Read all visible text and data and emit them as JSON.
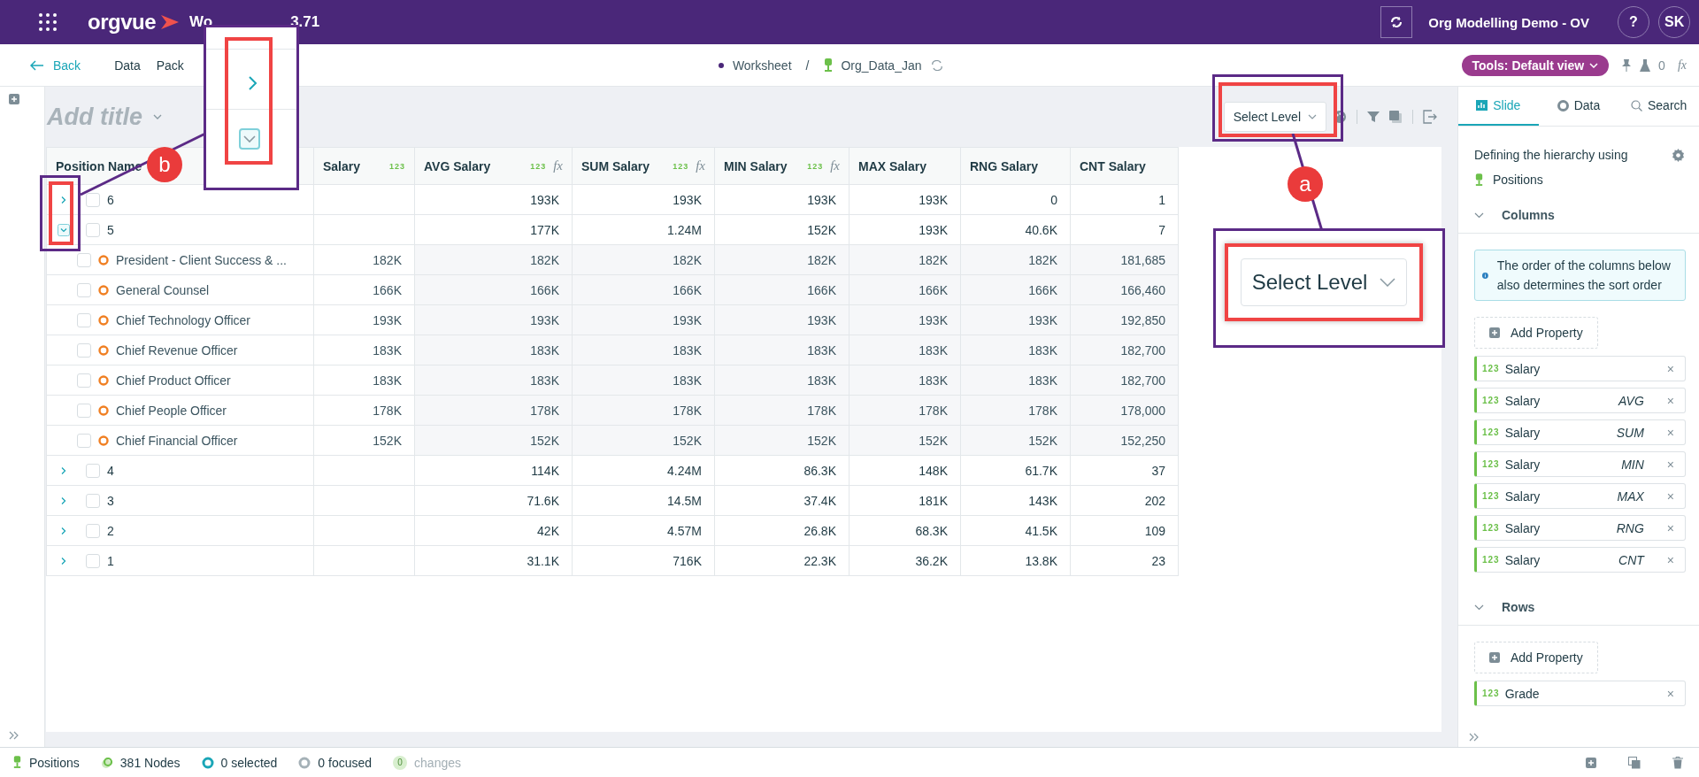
{
  "top_bar": {
    "app_name": "orgvue",
    "title_start": "Wo",
    "title_end": "3.71",
    "project": "Org Modelling Demo - OV",
    "help": "?",
    "avatar": "SK"
  },
  "nav": {
    "back": "Back",
    "items": [
      "Data",
      "Pack"
    ],
    "breadcrumb": [
      "Worksheet",
      "/",
      "Org_Data_Jan"
    ],
    "tools": "Tools: Default view",
    "count": "0",
    "fx": "fx"
  },
  "toolbar": {
    "title_placeholder": "Add title",
    "select_level": "Select Level"
  },
  "table": {
    "columns": [
      {
        "label": "Position Name"
      },
      {
        "label": "Salary",
        "tag": "123"
      },
      {
        "label": "AVG Salary",
        "tag": "123",
        "fx": "fx"
      },
      {
        "label": "SUM Salary",
        "tag": "123",
        "fx": "fx"
      },
      {
        "label": "MIN Salary",
        "tag": "123",
        "fx": "fx"
      },
      {
        "label": "MAX Salary"
      },
      {
        "label": "RNG Salary"
      },
      {
        "label": "CNT Salary"
      }
    ],
    "rows": [
      {
        "kind": "group",
        "expanded": false,
        "checked": false,
        "cells": [
          "6",
          "",
          "193K",
          "193K",
          "193K",
          "193K",
          "0",
          "1"
        ]
      },
      {
        "kind": "group",
        "expanded": true,
        "checked": false,
        "cells": [
          "5",
          "",
          "177K",
          "1.24M",
          "152K",
          "193K",
          "40.6K",
          "7"
        ]
      },
      {
        "kind": "position",
        "checked": false,
        "cells": [
          "President -  Client Success & ...",
          "182K",
          "182K",
          "182K",
          "182K",
          "182K",
          "182K",
          "181,685"
        ]
      },
      {
        "kind": "position",
        "checked": false,
        "cells": [
          "General Counsel",
          "166K",
          "166K",
          "166K",
          "166K",
          "166K",
          "166K",
          "166,460"
        ]
      },
      {
        "kind": "position",
        "checked": false,
        "cells": [
          "Chief Technology Officer",
          "193K",
          "193K",
          "193K",
          "193K",
          "193K",
          "193K",
          "192,850"
        ]
      },
      {
        "kind": "position",
        "checked": false,
        "cells": [
          "Chief Revenue Officer",
          "183K",
          "183K",
          "183K",
          "183K",
          "183K",
          "183K",
          "182,700"
        ]
      },
      {
        "kind": "position",
        "checked": false,
        "cells": [
          "Chief Product Officer",
          "183K",
          "183K",
          "183K",
          "183K",
          "183K",
          "183K",
          "182,700"
        ]
      },
      {
        "kind": "position",
        "checked": false,
        "cells": [
          "Chief People Officer",
          "178K",
          "178K",
          "178K",
          "178K",
          "178K",
          "178K",
          "178,000"
        ]
      },
      {
        "kind": "position",
        "checked": false,
        "cells": [
          "Chief Financial Officer",
          "152K",
          "152K",
          "152K",
          "152K",
          "152K",
          "152K",
          "152,250"
        ]
      },
      {
        "kind": "group",
        "expanded": false,
        "checked": false,
        "cells": [
          "4",
          "",
          "114K",
          "4.24M",
          "86.3K",
          "148K",
          "61.7K",
          "37"
        ]
      },
      {
        "kind": "group",
        "expanded": false,
        "checked": false,
        "cells": [
          "3",
          "",
          "71.6K",
          "14.5M",
          "37.4K",
          "181K",
          "143K",
          "202"
        ]
      },
      {
        "kind": "group",
        "expanded": false,
        "checked": false,
        "cells": [
          "2",
          "",
          "42K",
          "4.57M",
          "26.8K",
          "68.3K",
          "41.5K",
          "109"
        ]
      },
      {
        "kind": "group",
        "expanded": false,
        "checked": false,
        "cells": [
          "1",
          "",
          "31.1K",
          "716K",
          "22.3K",
          "36.2K",
          "13.8K",
          "23"
        ]
      }
    ]
  },
  "panel": {
    "tabs": [
      {
        "label": "Slide",
        "selected": true
      },
      {
        "label": "Data",
        "selected": false
      },
      {
        "label": "Search",
        "selected": false
      }
    ],
    "hierarchy_text": "Defining the hierarchy using",
    "hierarchy_value": "Positions",
    "columns_section": {
      "title": "Columns",
      "expanded": true,
      "info": "The order of the columns below also determines the sort order",
      "add": "Add Property",
      "properties": [
        {
          "tag": "123",
          "name": "Salary",
          "remove": "×"
        },
        {
          "tag": "123",
          "name": "Salary",
          "agg": "AVG",
          "remove": "×"
        },
        {
          "tag": "123",
          "name": "Salary",
          "agg": "SUM",
          "remove": "×"
        },
        {
          "tag": "123",
          "name": "Salary",
          "agg": "MIN",
          "remove": "×"
        },
        {
          "tag": "123",
          "name": "Salary",
          "agg": "MAX",
          "remove": "×"
        },
        {
          "tag": "123",
          "name": "Salary",
          "agg": "RNG",
          "remove": "×"
        },
        {
          "tag": "123",
          "name": "Salary",
          "agg": "CNT",
          "remove": "×"
        }
      ]
    },
    "rows_section": {
      "title": "Rows",
      "expanded": true,
      "add": "Add Property",
      "properties": [
        {
          "tag": "123",
          "name": "Grade",
          "remove": "×"
        }
      ]
    }
  },
  "status_bar": [
    {
      "kind": "positions",
      "label": "Positions",
      "disabled": false
    },
    {
      "kind": "nodes",
      "label": "381 Nodes",
      "disabled": false
    },
    {
      "kind": "selected",
      "label": "0 selected",
      "disabled": false
    },
    {
      "kind": "focused",
      "label": "0 focused",
      "disabled": false
    },
    {
      "kind": "changes",
      "badge": "0",
      "label": "changes",
      "disabled": true
    }
  ],
  "annotations": [
    {
      "marker": "b"
    },
    {
      "marker": "a",
      "label": "Select Level"
    }
  ]
}
